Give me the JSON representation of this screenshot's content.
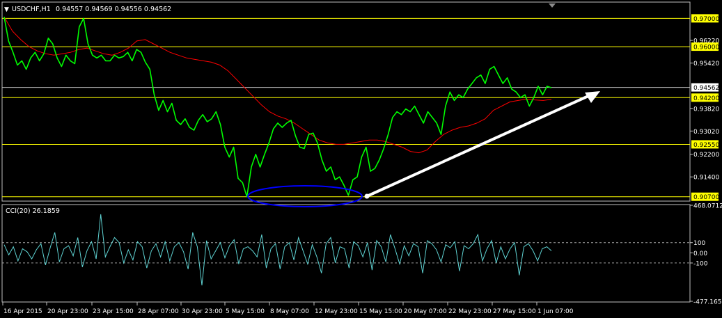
{
  "colors": {
    "background": "#000000",
    "frame": "#c0c0c0",
    "price": "#00ff00",
    "moving_average": "#ff0000",
    "level_line": "#ffff00",
    "current_line": "#c0c0c0",
    "label_fill": "#ffff00",
    "current_label_fill": "#ffffff",
    "cci": "#5fd3d3",
    "cci_level": "#a0a0a0",
    "text": "#ffffff",
    "ellipse": "#0000ff",
    "arrow": "#ffffff"
  },
  "header": {
    "symbol": "USDCHF,H1",
    "ohlc": "0.94557 0.94569 0.94556 0.94562"
  },
  "cci_header": "CCI(20) 26.1859",
  "chart_data": [
    {
      "type": "line",
      "name": "USDCHF,H1 price",
      "ylim": [
        0.9057,
        0.9755
      ],
      "y_ticks": [
        "0.97000",
        "0.96220",
        "0.96000",
        "0.95420",
        "0.94562",
        "0.94200",
        "0.93820",
        "0.93020",
        "0.92550",
        "0.92200",
        "0.91400",
        "0.90700"
      ],
      "x_ticks": [
        "16 Apr 2015",
        "20 Apr 23:00",
        "23 Apr 15:00",
        "28 Apr 07:00",
        "30 Apr 23:00",
        "5 May 15:00",
        "8 May 07:00",
        "12 May 23:00",
        "15 May 15:00",
        "20 May 07:00",
        "22 May 23:00",
        "27 May 15:00",
        "1 Jun 07:00"
      ],
      "horizontal_levels": [
        0.97,
        0.96,
        0.942,
        0.9255,
        0.907
      ],
      "current_price": 0.94562,
      "series": [
        {
          "values": [
            0.9705,
            0.962,
            0.958,
            0.9535,
            0.955,
            0.952,
            0.956,
            0.958,
            0.955,
            0.9575,
            0.963,
            0.961,
            0.956,
            0.953,
            0.957,
            0.955,
            0.954,
            0.967,
            0.97,
            0.961,
            0.957,
            0.956,
            0.957,
            0.955,
            0.955,
            0.957,
            0.956,
            0.9565,
            0.958,
            0.955,
            0.959,
            0.958,
            0.9545,
            0.952,
            0.943,
            0.9375,
            0.941,
            0.937,
            0.94,
            0.934,
            0.9325,
            0.9345,
            0.9315,
            0.9305,
            0.934,
            0.936,
            0.9335,
            0.9345,
            0.937,
            0.9325,
            0.9245,
            0.921,
            0.9245,
            0.9135,
            0.912,
            0.907,
            0.9175,
            0.922,
            0.9175,
            0.922,
            0.926,
            0.931,
            0.933,
            0.9315,
            0.933,
            0.934,
            0.9285,
            0.9245,
            0.924,
            0.929,
            0.9295,
            0.926,
            0.92,
            0.916,
            0.9175,
            0.913,
            0.914,
            0.911,
            0.9075,
            0.913,
            0.914,
            0.921,
            0.9245,
            0.916,
            0.917,
            0.92,
            0.924,
            0.929,
            0.935,
            0.937,
            0.936,
            0.938,
            0.937,
            0.939,
            0.936,
            0.933,
            0.937,
            0.935,
            0.933,
            0.929,
            0.939,
            0.944,
            0.941,
            0.943,
            0.942,
            0.945,
            0.947,
            0.949,
            0.95,
            0.947,
            0.952,
            0.953,
            0.95,
            0.947,
            0.949,
            0.945,
            0.944,
            0.942,
            0.943,
            0.939,
            0.942,
            0.946,
            0.943,
            0.946,
            0.9455
          ]
        },
        {
          "values": [
            0.9705,
            0.9655,
            0.9625,
            0.96,
            0.9585,
            0.9575,
            0.957,
            0.9575,
            0.958,
            0.959,
            0.9595,
            0.9585,
            0.9575,
            0.957,
            0.958,
            0.9595,
            0.962,
            0.9625,
            0.961,
            0.9595,
            0.958,
            0.957,
            0.956,
            0.9555,
            0.955,
            0.9545,
            0.9535,
            0.9515,
            0.9485,
            0.9455,
            0.9425,
            0.9395,
            0.937,
            0.9355,
            0.9345,
            0.933,
            0.931,
            0.929,
            0.927,
            0.926,
            0.9255,
            0.9255,
            0.926,
            0.9265,
            0.927,
            0.927,
            0.9265,
            0.9255,
            0.9245,
            0.923,
            0.9225,
            0.9235,
            0.9265,
            0.929,
            0.9305,
            0.9315,
            0.932,
            0.933,
            0.9345,
            0.9375,
            0.939,
            0.9405,
            0.941,
            0.9415,
            0.9412,
            0.941,
            0.9414
          ]
        }
      ]
    },
    {
      "type": "line",
      "name": "CCI(20)",
      "ylim": [
        -477.1659,
        468.0712
      ],
      "y_ticks": [
        "468.0712",
        "100",
        "0.00",
        "-100",
        "-477.1659"
      ],
      "levels": [
        100,
        0,
        -100
      ],
      "values": [
        80,
        -20,
        60,
        -80,
        40,
        10,
        -60,
        30,
        90,
        -120,
        50,
        200,
        -90,
        40,
        70,
        -30,
        150,
        -140,
        20,
        110,
        -60,
        380,
        -40,
        60,
        150,
        100,
        -100,
        30,
        -70,
        110,
        60,
        -150,
        20,
        90,
        -40,
        110,
        -80,
        60,
        100,
        10,
        -160,
        200,
        60,
        -320,
        120,
        -60,
        20,
        100,
        -50,
        70,
        130,
        -110,
        40,
        60,
        20,
        -40,
        180,
        -150,
        40,
        90,
        -160,
        60,
        100,
        -70,
        150,
        20,
        -110,
        80,
        -40,
        -200,
        90,
        150,
        -100,
        60,
        40,
        -150,
        110,
        70,
        -40,
        100,
        -170,
        120,
        60,
        -90,
        180,
        40,
        -110,
        70,
        -30,
        90,
        60,
        -200,
        120,
        90,
        30,
        -90,
        80,
        50,
        110,
        -180,
        70,
        40,
        90,
        180,
        -80,
        40,
        120,
        -100,
        60,
        -60,
        40,
        100,
        -220,
        60,
        90,
        20,
        -80,
        40,
        60,
        20
      ]
    }
  ],
  "annotations": {
    "ellipse_label": "",
    "arrow_label": ""
  }
}
